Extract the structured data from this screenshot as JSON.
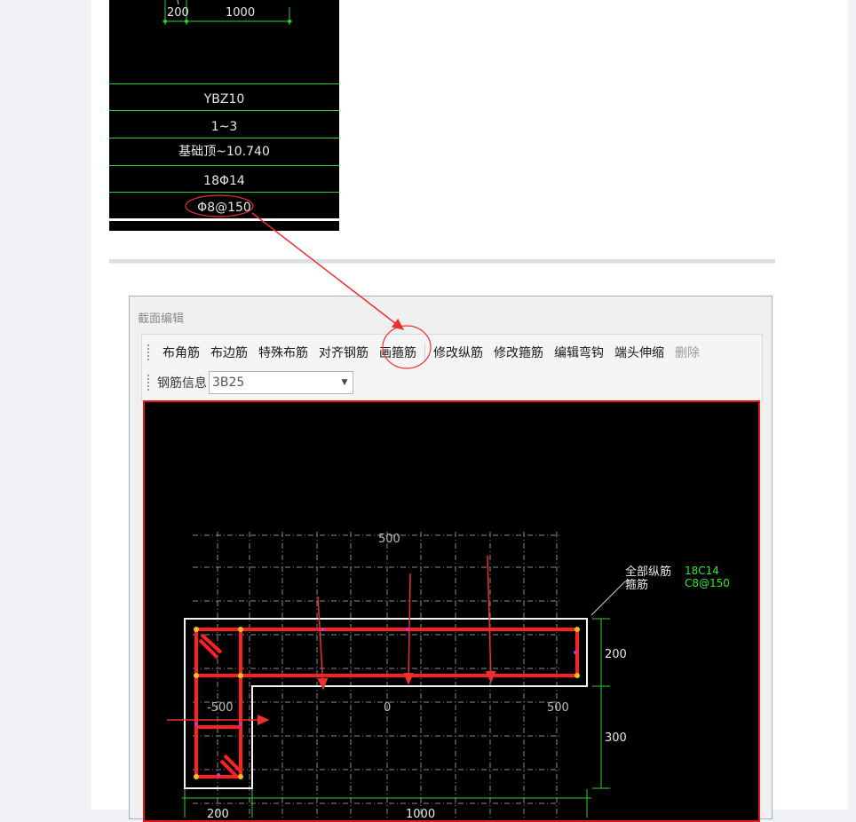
{
  "top_drawing": {
    "dims": [
      "200",
      "1000"
    ],
    "rows": [
      "YBZ10",
      "1~3",
      "基础顶~10.740",
      "18Φ14",
      "Φ8@150"
    ]
  },
  "dialog": {
    "title": "截面编辑",
    "toolbar": {
      "buttons": [
        "布角筋",
        "布边筋",
        "特殊布筋",
        "对齐钢筋",
        "画箍筋",
        "修改纵筋",
        "修改箍筋",
        "编辑弯钩",
        "端头伸缩",
        "删除"
      ],
      "rebar_info_label": "钢筋信息",
      "rebar_info_value": "3B25"
    }
  },
  "section_canvas": {
    "axis_labels": [
      "500",
      "-500",
      "0",
      "500"
    ],
    "dim_labels": [
      "200",
      "300",
      "200",
      "1000"
    ],
    "leader_labels": [
      "全部纵筋",
      "箍筋"
    ],
    "rebar_values": [
      "18C14",
      "C8@150"
    ]
  },
  "colors": {
    "cad_background": "#000000",
    "cad_row_line": "#2fd02f",
    "stirrup": "#ff2020",
    "dimension": "#2fd02f",
    "annotation_arrow": "#ee3030",
    "rebar_value_text": "#2ee82e"
  }
}
